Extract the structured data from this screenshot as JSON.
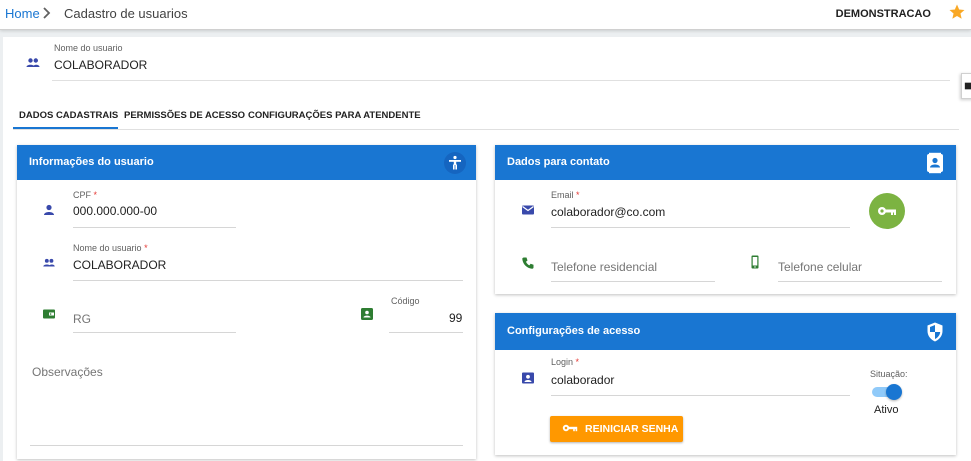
{
  "breadcrumb": {
    "home": "Home",
    "current": "Cadastro de usuarios"
  },
  "company": "DEMONSTRACAO",
  "header": {
    "label": "Nome do usuario",
    "value": "COLABORADOR"
  },
  "tabs": [
    "DADOS CADASTRAIS",
    "PERMISSÕES DE ACESSO",
    "CONFIGURAÇÕES PARA ATENDENTE"
  ],
  "active_tab": "DADOS CADASTRAIS",
  "info_panel": {
    "title": "Informações do usuario",
    "cpf": {
      "label": "CPF",
      "value": "000.000.000-00"
    },
    "nome": {
      "label": "Nome do usuario",
      "value": "COLABORADOR"
    },
    "rg": {
      "placeholder": "RG"
    },
    "codigo": {
      "label": "Código",
      "value": "99"
    },
    "observacoes": {
      "placeholder": "Observações"
    }
  },
  "contact_panel": {
    "title": "Dados para contato",
    "email": {
      "label": "Email",
      "value": "colaborador@co.com"
    },
    "telefone_residencial": {
      "placeholder": "Telefone residencial"
    },
    "telefone_celular": {
      "placeholder": "Telefone celular"
    }
  },
  "access_panel": {
    "title": "Configurações de acesso",
    "login": {
      "label": "Login",
      "value": "colaborador"
    },
    "situacao": {
      "label": "Situação:",
      "state": "Ativo",
      "on": true
    },
    "reset_button": "REINICIAR SENHA"
  },
  "required_mark": "*",
  "colors": {
    "primary": "#1976d2",
    "green": "#7cb342",
    "orange": "#ff9800",
    "star": "#f9a825",
    "icon_green": "#2e7d32",
    "icon_indigo": "#3949ab"
  }
}
